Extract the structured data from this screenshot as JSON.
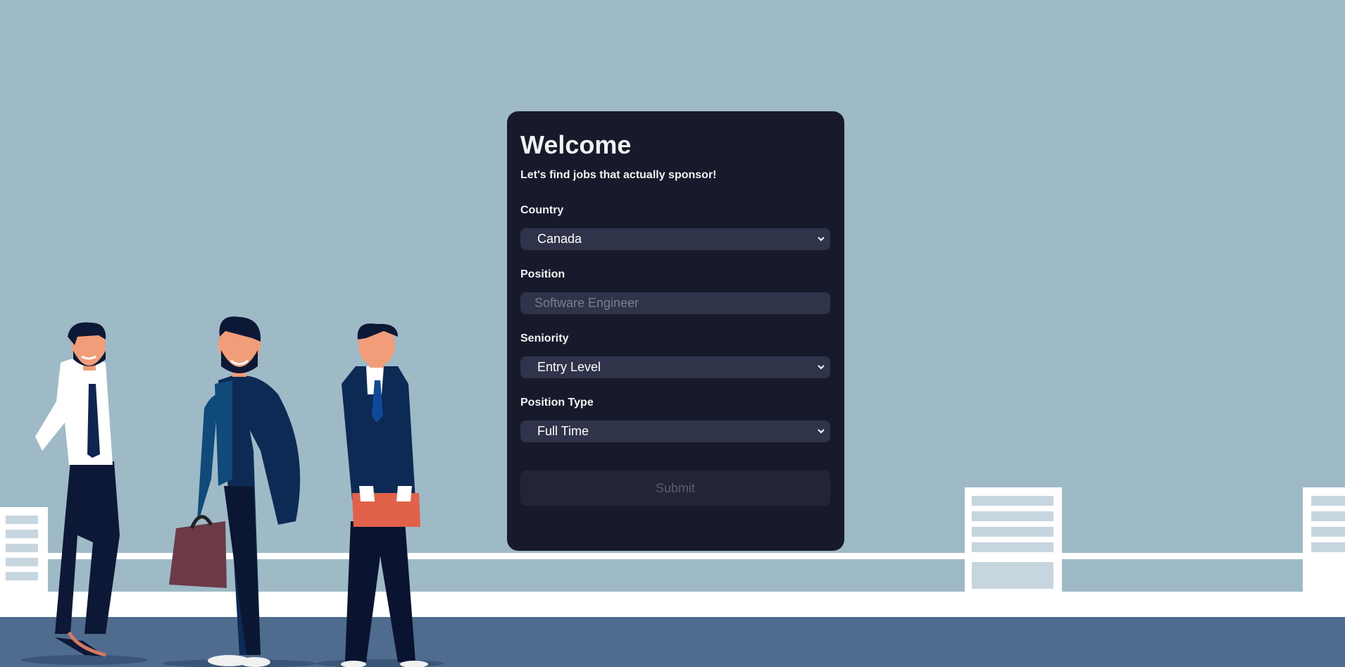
{
  "card": {
    "title": "Welcome",
    "subtitle": "Let's find jobs that actually sponsor!"
  },
  "form": {
    "country": {
      "label": "Country",
      "value": "Canada"
    },
    "position": {
      "label": "Position",
      "placeholder": "Software Engineer"
    },
    "seniority": {
      "label": "Seniority",
      "value": "Entry Level"
    },
    "position_type": {
      "label": "Position Type",
      "value": "Full Time"
    },
    "submit_label": "Submit"
  },
  "colors": {
    "background": "#9dbac6",
    "card": "#161a2a",
    "field": "#30344a",
    "submit_disabled": "#222534"
  }
}
